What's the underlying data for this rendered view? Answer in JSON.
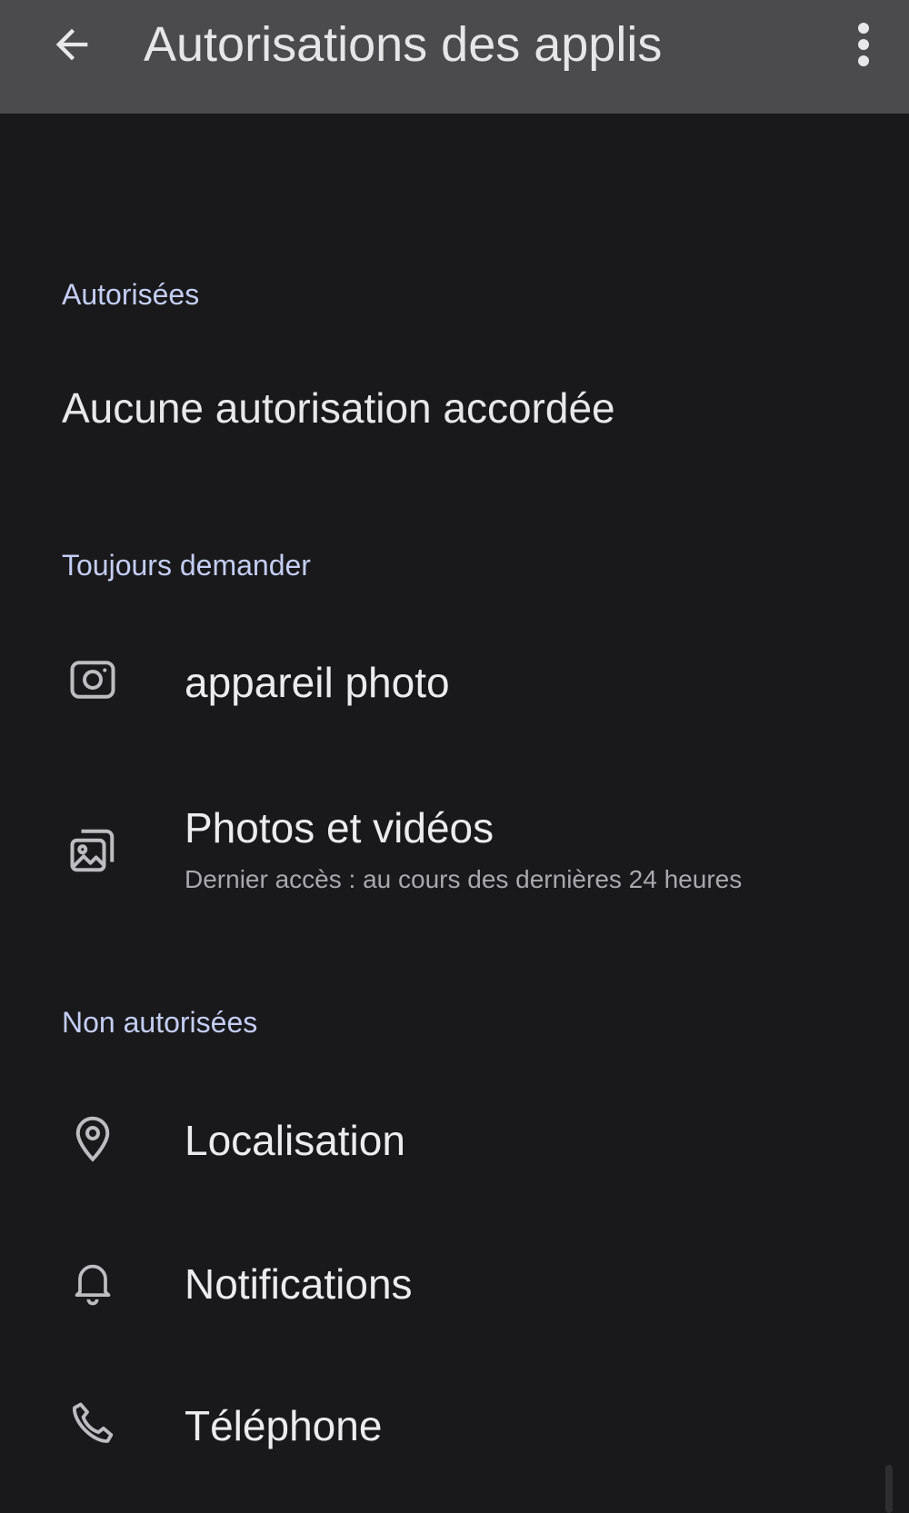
{
  "toolbar": {
    "title": "Autorisations des applis",
    "back_icon": "arrow-back-icon",
    "more_icon": "more-vert-icon"
  },
  "sections": {
    "allowed": {
      "header": "Autorisées",
      "empty_text": "Aucune autorisation accordée"
    },
    "ask": {
      "header": "Toujours demander",
      "items": [
        {
          "label": "appareil photo",
          "icon": "camera-icon"
        },
        {
          "label": "Photos et vidéos",
          "subtitle": "Dernier accès : au cours des dernières 24 heures",
          "icon": "photos-videos-icon"
        }
      ]
    },
    "denied": {
      "header": "Non autorisées",
      "items": [
        {
          "label": "Localisation",
          "icon": "location-pin-icon"
        },
        {
          "label": "Notifications",
          "icon": "bell-icon"
        },
        {
          "label": "Téléphone",
          "icon": "phone-icon"
        }
      ]
    }
  },
  "colors": {
    "background": "#19191b",
    "toolbar": "#4b4b4d",
    "section_header": "#c4cdf3",
    "primary_text": "#ececee",
    "secondary_text": "#a8a8ad"
  }
}
